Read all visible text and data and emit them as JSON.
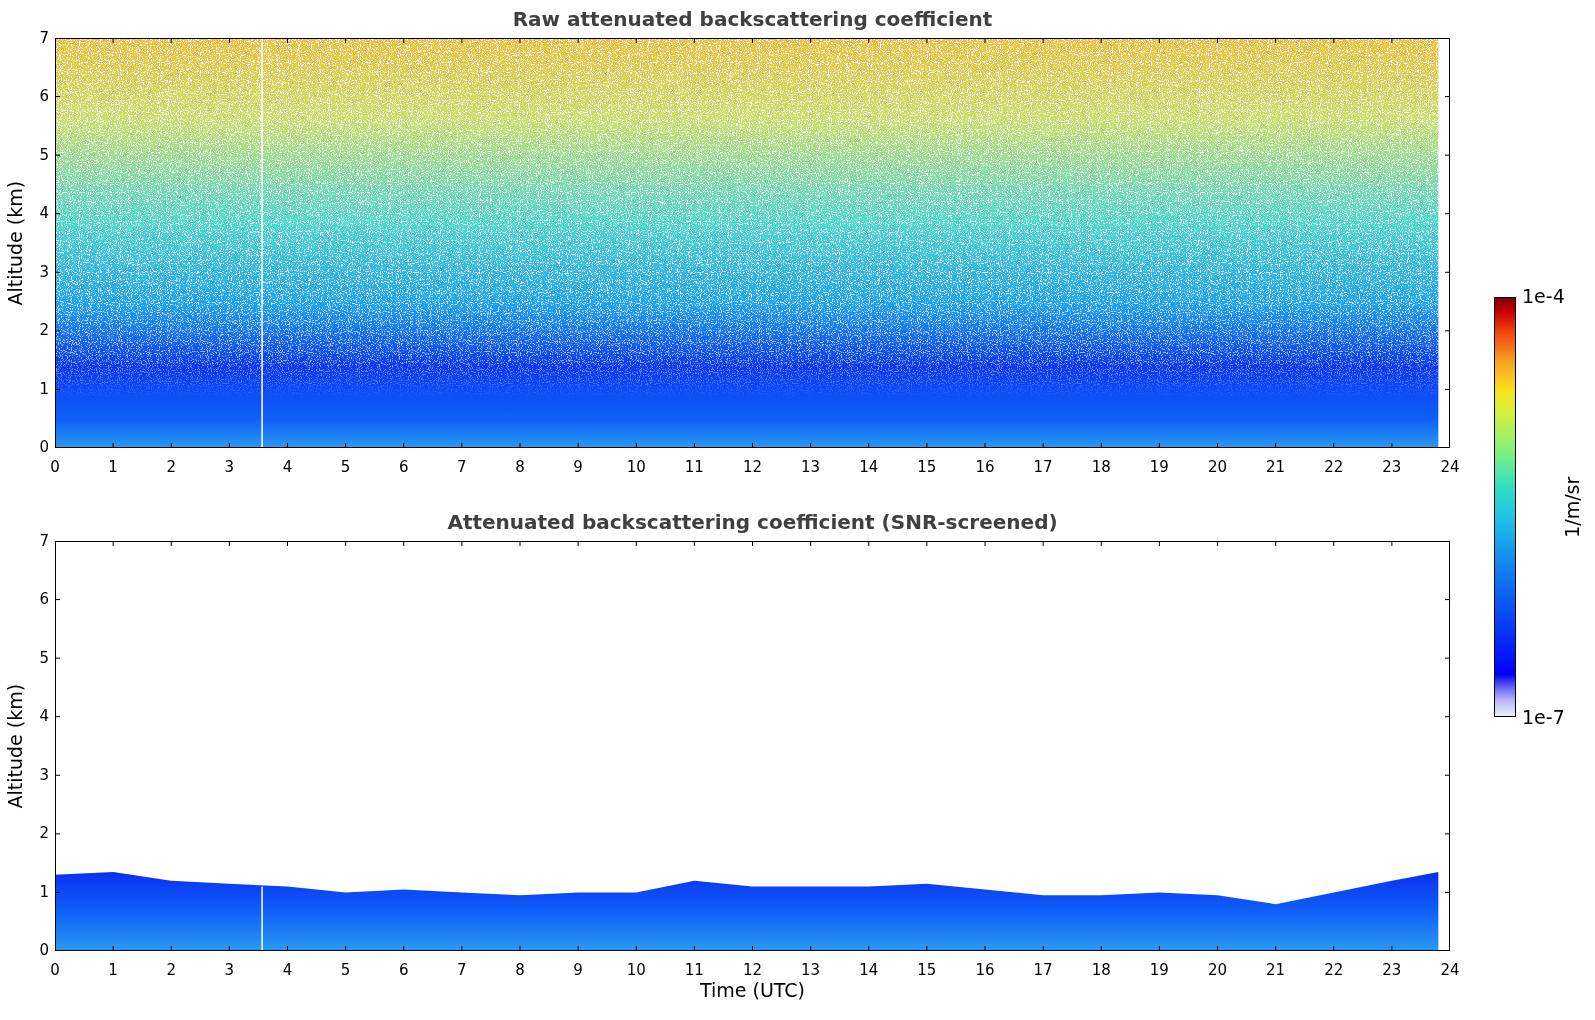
{
  "panels": [
    {
      "kind": "raw",
      "title": "Raw attenuated backscattering coefficient",
      "ylabel": "Altitude (km)",
      "yticks": [
        "7",
        "6",
        "5",
        "4",
        "3",
        "2",
        "1",
        "0"
      ],
      "xticks": [
        "0",
        "1",
        "2",
        "3",
        "4",
        "5",
        "6",
        "7",
        "8",
        "9",
        "10",
        "11",
        "12",
        "13",
        "14",
        "15",
        "16",
        "17",
        "18",
        "19",
        "20",
        "21",
        "22",
        "23",
        "24"
      ]
    },
    {
      "kind": "screened",
      "title": "Attenuated backscattering coefficient (SNR-screened)",
      "ylabel": "Altitude (km)",
      "xlabel": "Time (UTC)",
      "yticks": [
        "7",
        "6",
        "5",
        "4",
        "3",
        "2",
        "1",
        "0"
      ],
      "xticks": [
        "0",
        "1",
        "2",
        "3",
        "4",
        "5",
        "6",
        "7",
        "8",
        "9",
        "10",
        "11",
        "12",
        "13",
        "14",
        "15",
        "16",
        "17",
        "18",
        "19",
        "20",
        "21",
        "22",
        "23",
        "24"
      ]
    }
  ],
  "colorbar": {
    "max_label": "1e-4",
    "min_label": "1e-7",
    "unit_label": "1/m/sr"
  }
}
